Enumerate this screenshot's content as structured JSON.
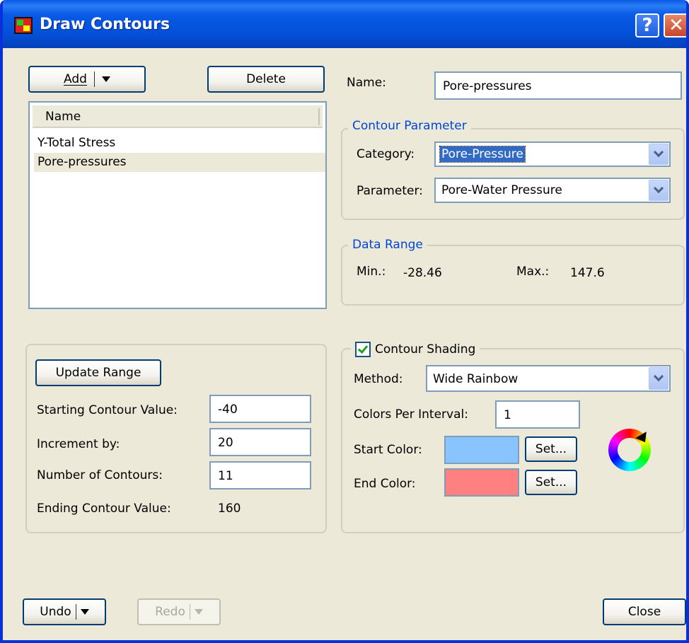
{
  "window": {
    "title": "Draw Contours",
    "help_glyph": "?",
    "close_glyph": "✕"
  },
  "toolbar": {
    "add_label": "Add",
    "delete_label": "Delete"
  },
  "contour_list": {
    "header": "Name",
    "items": [
      {
        "label": "Y-Total Stress"
      },
      {
        "label": "Pore-pressures",
        "selected": true
      }
    ]
  },
  "name_field": {
    "label": "Name:",
    "value": "Pore-pressures"
  },
  "contour_parameter": {
    "title": "Contour Parameter",
    "category_label": "Category:",
    "category_value": "Pore-Pressure",
    "parameter_label": "Parameter:",
    "parameter_value": "Pore-Water Pressure"
  },
  "data_range": {
    "title": "Data Range",
    "min_label": "Min.:",
    "min_value": "-28.46",
    "max_label": "Max.:",
    "max_value": "147.6"
  },
  "range_settings": {
    "update_label": "Update Range",
    "start_label": "Starting Contour Value:",
    "start_value": "-40",
    "increment_label": "Increment by:",
    "increment_value": "20",
    "count_label": "Number of Contours:",
    "count_value": "11",
    "end_label": "Ending Contour Value:",
    "end_value": "160"
  },
  "shading": {
    "checkbox_label": "Contour Shading",
    "checked": true,
    "method_label": "Method:",
    "method_value": "Wide Rainbow",
    "colors_per_interval_label": "Colors Per Interval:",
    "colors_per_interval_value": "1",
    "start_color_label": "Start Color:",
    "start_color": "#8ac4ff",
    "end_color_label": "End Color:",
    "end_color": "#ff8080",
    "set_label": "Set..."
  },
  "footer": {
    "undo_label": "Undo",
    "redo_label": "Redo",
    "close_label": "Close"
  },
  "colors": {
    "accent": "#0046d5",
    "selection": "#316ac5",
    "titlebar": "#0a5ae6"
  }
}
